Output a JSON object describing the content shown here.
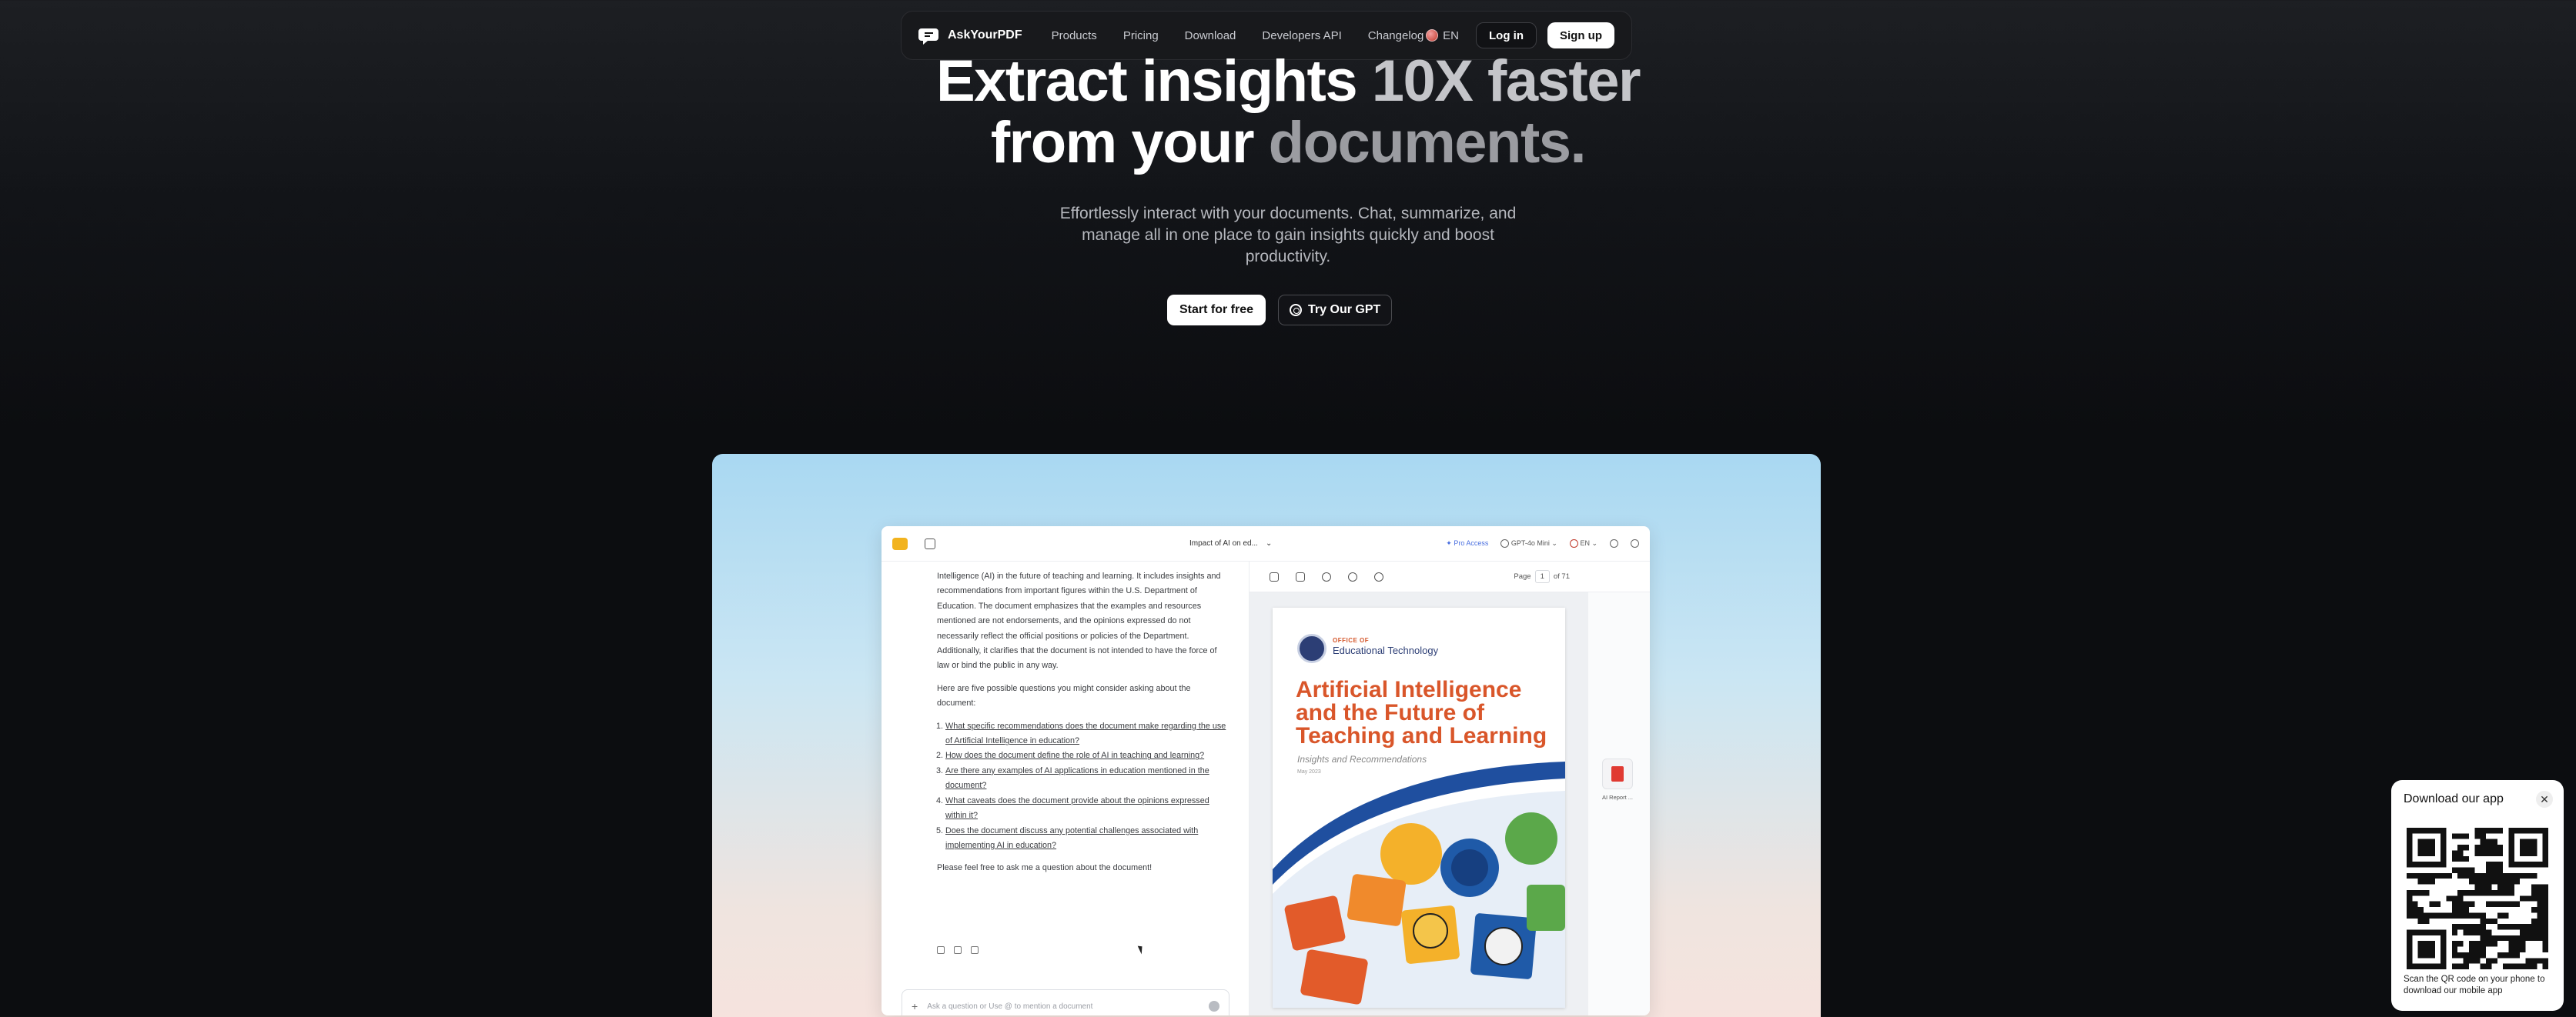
{
  "nav": {
    "brand": "AskYourPDF",
    "links": [
      "Products",
      "Pricing",
      "Download",
      "Developers API",
      "Changelog"
    ],
    "language": "EN",
    "login": "Log in",
    "signup": "Sign up"
  },
  "hero": {
    "title_line1_a": "Extract insights ",
    "title_line1_b": "10X faster",
    "title_line2_a": "from your ",
    "title_line2_b": "documents.",
    "subtitle": "Effortlessly interact with your documents. Chat, summarize, and manage all in one place to gain insights quickly and boost productivity.",
    "cta_primary": "Start for free",
    "cta_secondary": "Try Our GPT"
  },
  "app": {
    "doc_selector": "Impact of AI on ed...",
    "pro_access": "Pro Access",
    "model": "GPT-4o Mini",
    "language": "EN",
    "chat": {
      "intro": "Intelligence (AI) in the future of teaching and learning. It includes insights and recommendations from important figures within the U.S. Department of Education. The document emphasizes that the examples and resources mentioned are not endorsements, and the opinions expressed do not necessarily reflect the official positions or policies of the Department. Additionally, it clarifies that the document is not intended to have the force of law or bind the public in any way.",
      "questions_lead": "Here are five possible questions you might consider asking about the document:",
      "questions": [
        "What specific recommendations does the document make regarding the use of Artificial Intelligence in education?",
        "How does the document define the role of AI in teaching and learning?",
        "Are there any examples of AI applications in education mentioned in the document?",
        "What caveats does the document provide about the opinions expressed within it?",
        "Does the document discuss any potential challenges associated with implementing AI in education?"
      ],
      "closing": "Please feel free to ask me a question about the document!",
      "input_placeholder": "Ask a question or Use @ to mention a document"
    },
    "pdf": {
      "page_label": "Page",
      "page_current": "1",
      "page_total": "of 71",
      "office_small": "OFFICE OF",
      "office_name": "Educational Technology",
      "cover_title": "Artificial Intelligence and the Future of Teaching and Learning",
      "cover_subtitle": "Insights and Recommendations",
      "cover_date": "May 2023",
      "side_file_label": "AI Report ..."
    }
  },
  "qr_popup": {
    "title": "Download our app",
    "caption": "Scan the QR code on your phone to download our mobile app"
  }
}
